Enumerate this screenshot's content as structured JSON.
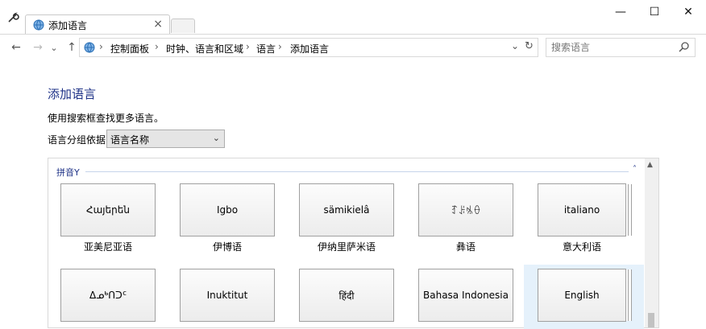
{
  "window": {
    "tab_title": "添加语言",
    "close_tab": "×",
    "minimize": "—",
    "maximize": "☐",
    "close": "✕"
  },
  "nav": {
    "back": "←",
    "forward": "→",
    "recent": "⌄",
    "up": "↑",
    "crumbs": [
      "控制面板",
      "时钟、语言和区域",
      "语言",
      "添加语言"
    ],
    "sep": "›",
    "dropdown": "⌄",
    "refresh": "↻"
  },
  "search": {
    "placeholder": "搜索语言"
  },
  "main": {
    "heading": "添加语言",
    "description": "使用搜索框查找更多语言。",
    "group_by_label": "语言分组依据:",
    "group_by_value": "语言名称"
  },
  "group": {
    "name": "拼音Y",
    "collapse": "˄"
  },
  "languages_row1": [
    {
      "native": "Հայերեն",
      "name": "亚美尼亚语"
    },
    {
      "native": "Igbo",
      "name": "伊博语"
    },
    {
      "native": "sämikielâ",
      "name": "伊纳里萨米语"
    },
    {
      "native": "ꆈꌠꁱꂷ",
      "name": "彝语"
    },
    {
      "native": "italiano",
      "name": "意大利语"
    }
  ],
  "languages_row2": [
    {
      "native": "ᐃᓄᒃᑎᑐᑦ"
    },
    {
      "native": "Inuktitut"
    },
    {
      "native": "हिंदी"
    },
    {
      "native": "Bahasa Indonesia"
    },
    {
      "native": "English"
    }
  ],
  "colors": {
    "heading": "#1e3287",
    "selected_bg": "#e5f1fb"
  }
}
